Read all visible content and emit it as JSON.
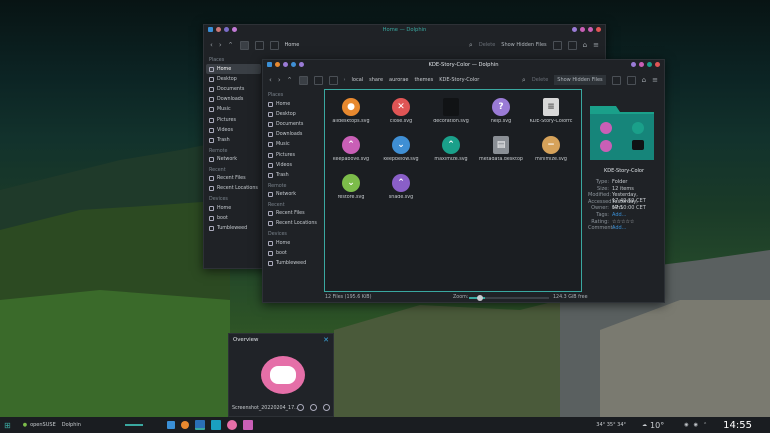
{
  "back_window": {
    "title": "Home — Dolphin",
    "crumb": "Home",
    "delete": "Delete",
    "hidden": "Show Hidden Files",
    "places_header": "Places",
    "places": [
      "Home",
      "Desktop",
      "Documents",
      "Downloads",
      "Music",
      "Pictures",
      "Videos",
      "Trash"
    ],
    "remote_header": "Remote",
    "remote": [
      "Network"
    ],
    "recent_header": "Recent",
    "recent": [
      "Recent Files",
      "Recent Locations"
    ],
    "devices_header": "Devices",
    "devices": [
      "Home",
      "boot",
      "Tumbleweed"
    ]
  },
  "front_window": {
    "title": "KDE-Story-Color — Dolphin",
    "crumbs": [
      "local",
      "share",
      "aurorae",
      "themes",
      "KDE-Story-Color"
    ],
    "delete": "Delete",
    "hidden": "Show Hidden Files",
    "places_header": "Places",
    "places": [
      "Home",
      "Desktop",
      "Documents",
      "Downloads",
      "Music",
      "Pictures",
      "Videos",
      "Trash"
    ],
    "remote_header": "Remote",
    "remote": [
      "Network"
    ],
    "recent_header": "Recent",
    "recent": [
      "Recent Files",
      "Recent Locations"
    ],
    "devices_header": "Devices",
    "devices": [
      "Home",
      "boot",
      "Tumbleweed"
    ],
    "files": [
      {
        "name": "alldesktops.svg",
        "color": "#e8892f",
        "glyph": "●",
        "icon": "circle-icon"
      },
      {
        "name": "close.svg",
        "color": "#e05555",
        "glyph": "✕",
        "icon": "close-icon"
      },
      {
        "name": "decoration.svg",
        "color": "#111315",
        "glyph": "",
        "icon": "blank-icon"
      },
      {
        "name": "help.svg",
        "color": "#9a7bd6",
        "glyph": "?",
        "icon": "help-icon"
      },
      {
        "name": "KDE-Story-Colorrc",
        "color": "#d8d8d8",
        "glyph": "≡",
        "icon": "document-icon"
      },
      {
        "name": "keepabove.svg",
        "color": "#c95fb6",
        "glyph": "⌃",
        "icon": "chevron-up-icon"
      },
      {
        "name": "keepbelow.svg",
        "color": "#3f8fd4",
        "glyph": "⌄",
        "icon": "chevron-down-icon"
      },
      {
        "name": "maximize.svg",
        "color": "#1aa08a",
        "glyph": "⌃",
        "icon": "maximize-icon"
      },
      {
        "name": "metadata.desktop",
        "color": "#8a8f95",
        "glyph": "▤",
        "icon": "desktop-file-icon"
      },
      {
        "name": "minimize.svg",
        "color": "#d6a25a",
        "glyph": "−",
        "icon": "minimize-icon"
      },
      {
        "name": "restore.svg",
        "color": "#7cbc4a",
        "glyph": "⌄",
        "icon": "restore-icon"
      },
      {
        "name": "shade.svg",
        "color": "#8a5fc8",
        "glyph": "⌃",
        "icon": "shade-icon"
      }
    ],
    "status": "12 Files (195.6 KiB)",
    "zoom": "Zoom:",
    "free": "124.3 GiB free",
    "info_name": "KDE-Story-Color",
    "info": [
      {
        "k": "Type:",
        "v": "Folder"
      },
      {
        "k": "Size:",
        "v": "12 items"
      },
      {
        "k": "Modified:",
        "v": "Yesterday, 17:49:59 CET"
      },
      {
        "k": "Accessed:",
        "v": "Yesterday, 17:50:00 CET"
      },
      {
        "k": "Owner:",
        "v": "f4h1"
      },
      {
        "k": "Tags:",
        "v": "Add..."
      },
      {
        "k": "Rating:",
        "v": "☆☆☆☆☆"
      },
      {
        "k": "Comment:",
        "v": "Add..."
      }
    ]
  },
  "overview": {
    "title": "Overview",
    "file": "Screenshot_20220204_17..."
  },
  "taskbar": {
    "distro": "openSUSE",
    "app": "Dolphin",
    "temps": "34° 35° 34°",
    "weather": "10°",
    "time": "14:55"
  }
}
